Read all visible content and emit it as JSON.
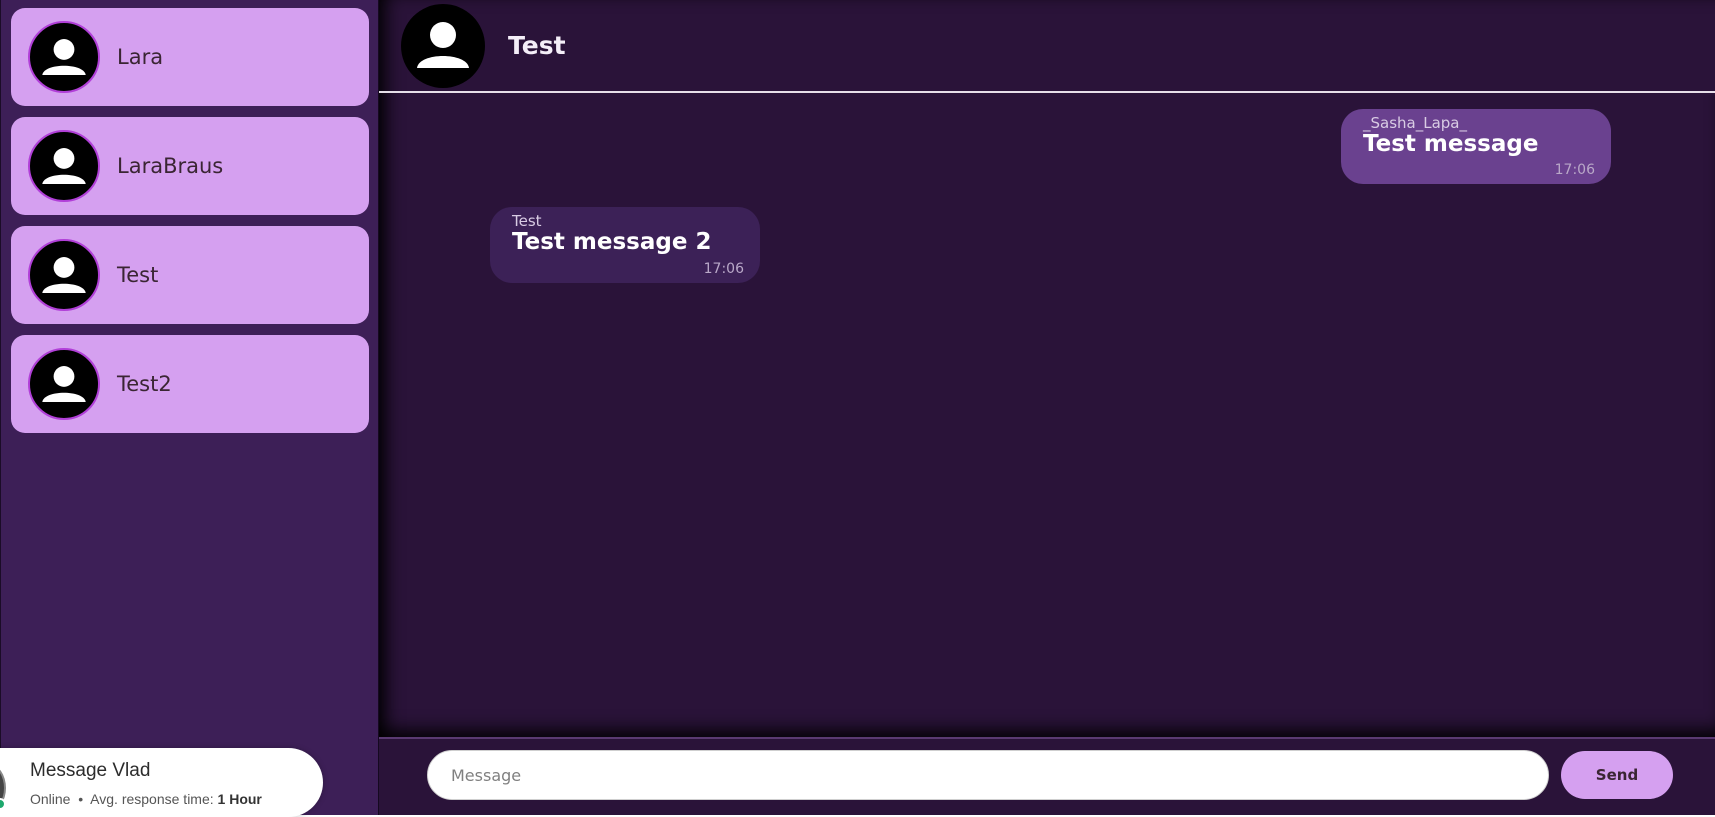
{
  "sidebar": {
    "contacts": [
      {
        "name": "Lara"
      },
      {
        "name": "LaraBraus"
      },
      {
        "name": "Test"
      },
      {
        "name": "Test2"
      }
    ]
  },
  "chat": {
    "title": "Test",
    "messages": [
      {
        "direction": "out",
        "sender": "_Sasha_Lapa_",
        "text": "Test message",
        "time": "17:06"
      },
      {
        "direction": "in",
        "sender": "Test",
        "text": "Test message 2",
        "time": "17:06"
      }
    ],
    "composer": {
      "placeholder": "Message",
      "send_label": "Send"
    }
  },
  "widget": {
    "title": "Message Vlad",
    "status": "Online",
    "separator": "•",
    "response_label": "Avg. response time:",
    "response_value": "1 Hour"
  },
  "colors": {
    "sidebar_bg": "#3d1f57",
    "contact_bg": "#d5a0f0",
    "chat_bg": "#2a1339",
    "bubble_out": "#6a418f",
    "bubble_in": "#3c2157",
    "online_dot": "#1ea86d"
  },
  "icons": {
    "avatar": "user-silhouette-icon"
  }
}
